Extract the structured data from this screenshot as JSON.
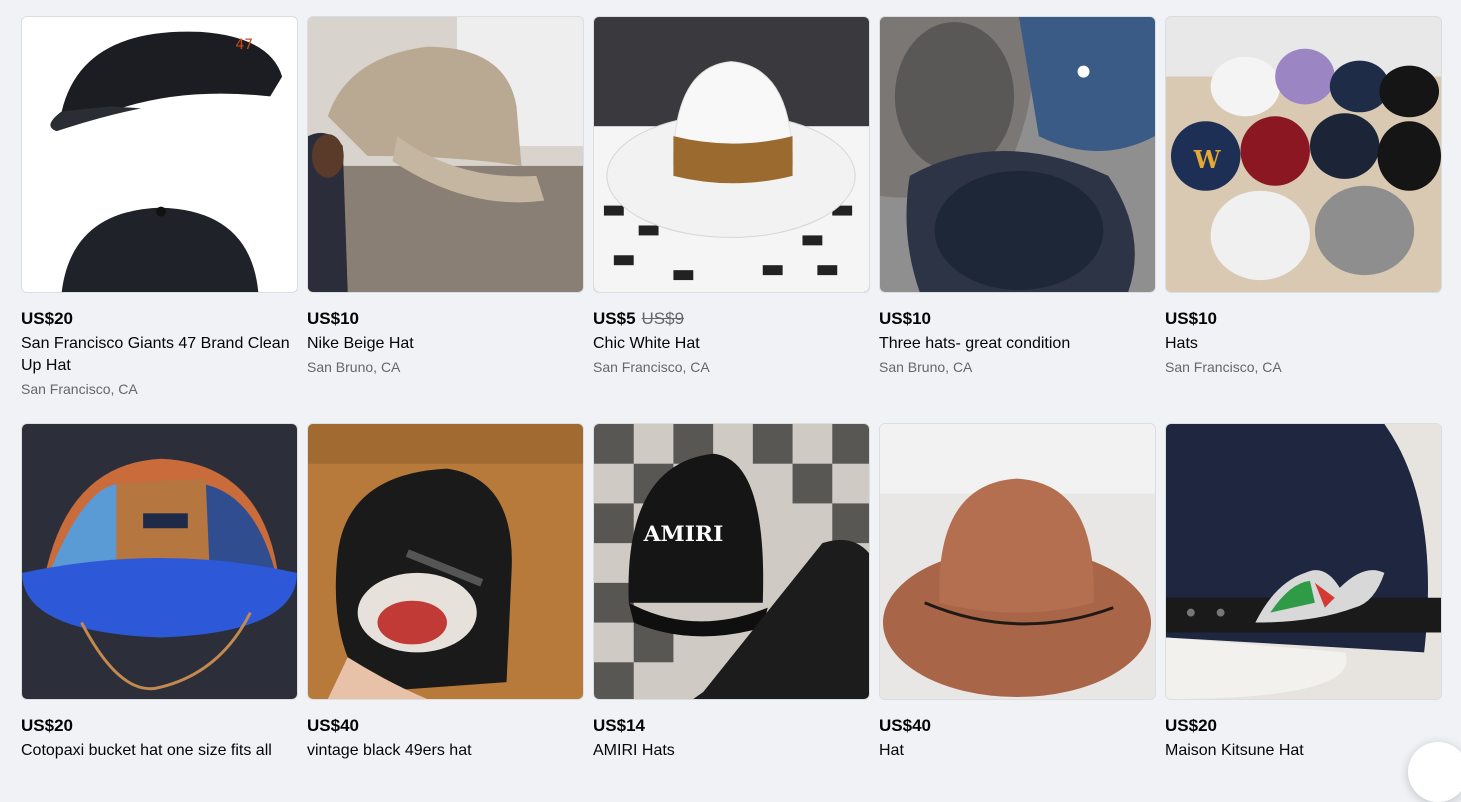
{
  "listings": [
    {
      "price": "US$20",
      "title": "San Francisco Giants 47 Brand Clean Up Hat",
      "location": "San Francisco, CA"
    },
    {
      "price": "US$10",
      "title": "Nike Beige Hat",
      "location": "San Bruno, CA"
    },
    {
      "price": "US$5",
      "old_price": "US$9",
      "title": "Chic White Hat",
      "location": "San Francisco, CA"
    },
    {
      "price": "US$10",
      "title": "Three hats- great condition",
      "location": "San Bruno, CA"
    },
    {
      "price": "US$10",
      "title": "Hats",
      "location": "San Francisco, CA"
    },
    {
      "price": "US$20",
      "title": "Cotopaxi bucket hat one size fits all"
    },
    {
      "price": "US$40",
      "title": "vintage black 49ers hat"
    },
    {
      "price": "US$14",
      "title": "AMIRI Hats"
    },
    {
      "price": "US$40",
      "title": "Hat"
    },
    {
      "price": "US$20",
      "title": "Maison Kitsune Hat"
    }
  ],
  "image_text": {
    "amiri_logo": "AMIRI"
  }
}
